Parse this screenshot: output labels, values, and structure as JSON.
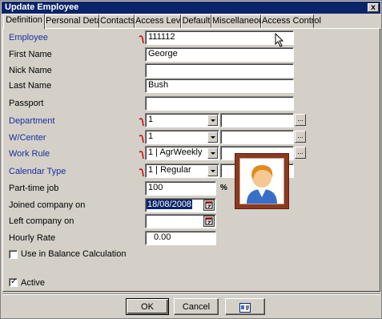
{
  "window": {
    "title": "Update Employee",
    "close_label": "x"
  },
  "tabs": [
    {
      "label": "Definition"
    },
    {
      "label": "Personal Details"
    },
    {
      "label": "Contacts"
    },
    {
      "label": "Access Level"
    },
    {
      "label": "Default"
    },
    {
      "label": "Miscellaneous"
    },
    {
      "label": "Access Control"
    }
  ],
  "form": {
    "employee": {
      "label": "Employee",
      "value": "111112"
    },
    "first_name": {
      "label": "First Name",
      "value": "George"
    },
    "nick_name": {
      "label": "Nick Name",
      "value": ""
    },
    "last_name": {
      "label": "Last Name",
      "value": "Bush"
    },
    "passport": {
      "label": "Passport",
      "value": ""
    },
    "department": {
      "label": "Department",
      "value": "1",
      "desc": "",
      "browse": "..."
    },
    "wcenter": {
      "label": "W/Center",
      "value": "1",
      "desc": "",
      "browse": "..."
    },
    "work_rule": {
      "label": "Work Rule",
      "value": "1  |  AgrWeekly",
      "desc": "",
      "browse": "..."
    },
    "calendar_type": {
      "label": "Calendar Type",
      "value": "1  |  Regular",
      "desc": ""
    },
    "part_time": {
      "label": "Part-time job",
      "value": "100",
      "unit": "%"
    },
    "joined": {
      "label": "Joined company on",
      "value": "18/08/2008"
    },
    "left": {
      "label": "Left company on",
      "value": ""
    },
    "hourly_rate": {
      "label": "Hourly Rate",
      "value": "0.00"
    },
    "balance_calc": {
      "label": "Use in Balance Calculation",
      "checked": false
    },
    "active": {
      "label": "Active",
      "checked": true,
      "mark": "✓"
    }
  },
  "buttons": {
    "ok": "OK",
    "cancel": "Cancel"
  },
  "colors": {
    "title_bar": "#0a246a",
    "required_mark": "#cc0000",
    "blue_label": "#1a2ea0",
    "photo_frame": "#8b3a1f"
  },
  "icons": [
    "close-icon",
    "required-icon",
    "dropdown-arrow-icon",
    "calendar-icon",
    "employee-photo-icon",
    "id-card-icon",
    "mouse-cursor-icon"
  ]
}
